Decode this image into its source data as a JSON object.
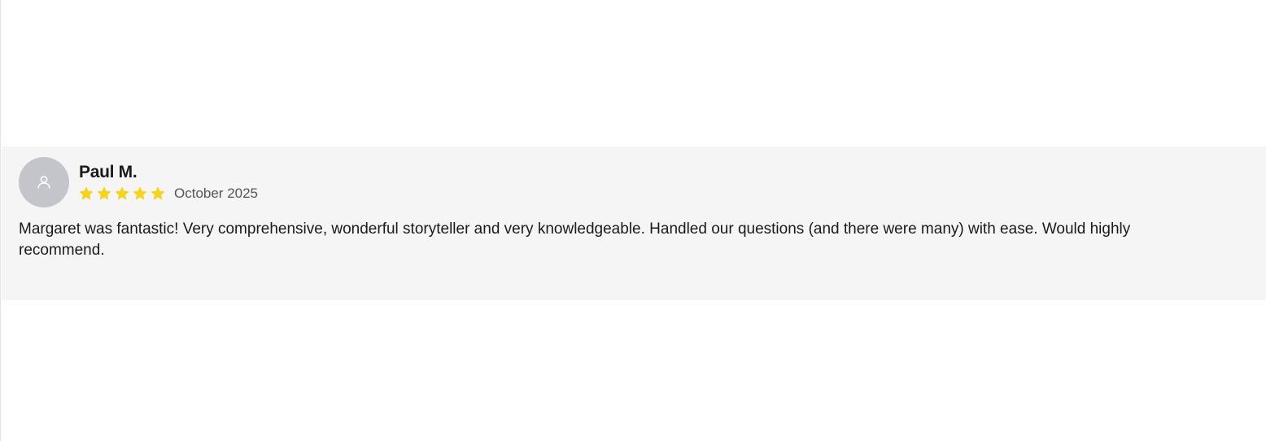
{
  "review": {
    "reviewer_name": "Paul M.",
    "rating": 5,
    "rating_max": 5,
    "date": "October 2025",
    "text": "Margaret was fantastic! Very comprehensive, wonderful storyteller and very knowledgeable. Handled our questions (and there were many) with ease. Would highly recommend.",
    "avatar_icon": "user-icon",
    "star_icon": "star-icon"
  },
  "colors": {
    "card_background": "#f5f5f5",
    "avatar_background": "#c3c5cb",
    "star": "#f7d417",
    "text": "#1a1a1a",
    "date_text": "#555555"
  }
}
